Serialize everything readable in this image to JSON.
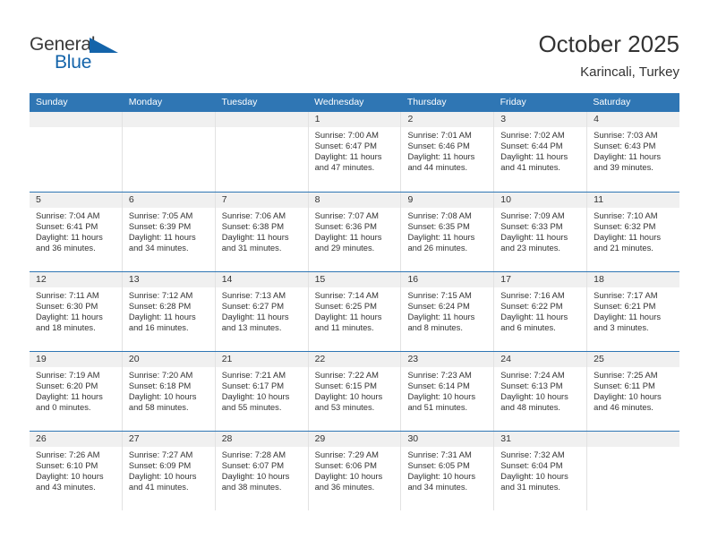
{
  "brand": {
    "name_part1": "General",
    "name_part2": "Blue",
    "accent_color": "#1464aa",
    "triangle_icon": "triangle-icon"
  },
  "header": {
    "title": "October 2025",
    "subtitle": "Karincali, Turkey"
  },
  "theme": {
    "header_blue": "#2f76b4",
    "date_band_gray": "#f0f0f0",
    "text_color": "#333333",
    "cell_divider": "#e2e2e2"
  },
  "calendar": {
    "weekday_headers": [
      "Sunday",
      "Monday",
      "Tuesday",
      "Wednesday",
      "Thursday",
      "Friday",
      "Saturday"
    ],
    "weeks": [
      [
        {
          "day": "",
          "empty": true,
          "sunrise": "",
          "sunset": "",
          "daylight_line1": "",
          "daylight_line2": ""
        },
        {
          "day": "",
          "empty": true,
          "sunrise": "",
          "sunset": "",
          "daylight_line1": "",
          "daylight_line2": ""
        },
        {
          "day": "",
          "empty": true,
          "sunrise": "",
          "sunset": "",
          "daylight_line1": "",
          "daylight_line2": ""
        },
        {
          "day": "1",
          "empty": false,
          "sunrise": "Sunrise: 7:00 AM",
          "sunset": "Sunset: 6:47 PM",
          "daylight_line1": "Daylight: 11 hours",
          "daylight_line2": "and 47 minutes."
        },
        {
          "day": "2",
          "empty": false,
          "sunrise": "Sunrise: 7:01 AM",
          "sunset": "Sunset: 6:46 PM",
          "daylight_line1": "Daylight: 11 hours",
          "daylight_line2": "and 44 minutes."
        },
        {
          "day": "3",
          "empty": false,
          "sunrise": "Sunrise: 7:02 AM",
          "sunset": "Sunset: 6:44 PM",
          "daylight_line1": "Daylight: 11 hours",
          "daylight_line2": "and 41 minutes."
        },
        {
          "day": "4",
          "empty": false,
          "sunrise": "Sunrise: 7:03 AM",
          "sunset": "Sunset: 6:43 PM",
          "daylight_line1": "Daylight: 11 hours",
          "daylight_line2": "and 39 minutes."
        }
      ],
      [
        {
          "day": "5",
          "empty": false,
          "sunrise": "Sunrise: 7:04 AM",
          "sunset": "Sunset: 6:41 PM",
          "daylight_line1": "Daylight: 11 hours",
          "daylight_line2": "and 36 minutes."
        },
        {
          "day": "6",
          "empty": false,
          "sunrise": "Sunrise: 7:05 AM",
          "sunset": "Sunset: 6:39 PM",
          "daylight_line1": "Daylight: 11 hours",
          "daylight_line2": "and 34 minutes."
        },
        {
          "day": "7",
          "empty": false,
          "sunrise": "Sunrise: 7:06 AM",
          "sunset": "Sunset: 6:38 PM",
          "daylight_line1": "Daylight: 11 hours",
          "daylight_line2": "and 31 minutes."
        },
        {
          "day": "8",
          "empty": false,
          "sunrise": "Sunrise: 7:07 AM",
          "sunset": "Sunset: 6:36 PM",
          "daylight_line1": "Daylight: 11 hours",
          "daylight_line2": "and 29 minutes."
        },
        {
          "day": "9",
          "empty": false,
          "sunrise": "Sunrise: 7:08 AM",
          "sunset": "Sunset: 6:35 PM",
          "daylight_line1": "Daylight: 11 hours",
          "daylight_line2": "and 26 minutes."
        },
        {
          "day": "10",
          "empty": false,
          "sunrise": "Sunrise: 7:09 AM",
          "sunset": "Sunset: 6:33 PM",
          "daylight_line1": "Daylight: 11 hours",
          "daylight_line2": "and 23 minutes."
        },
        {
          "day": "11",
          "empty": false,
          "sunrise": "Sunrise: 7:10 AM",
          "sunset": "Sunset: 6:32 PM",
          "daylight_line1": "Daylight: 11 hours",
          "daylight_line2": "and 21 minutes."
        }
      ],
      [
        {
          "day": "12",
          "empty": false,
          "sunrise": "Sunrise: 7:11 AM",
          "sunset": "Sunset: 6:30 PM",
          "daylight_line1": "Daylight: 11 hours",
          "daylight_line2": "and 18 minutes."
        },
        {
          "day": "13",
          "empty": false,
          "sunrise": "Sunrise: 7:12 AM",
          "sunset": "Sunset: 6:28 PM",
          "daylight_line1": "Daylight: 11 hours",
          "daylight_line2": "and 16 minutes."
        },
        {
          "day": "14",
          "empty": false,
          "sunrise": "Sunrise: 7:13 AM",
          "sunset": "Sunset: 6:27 PM",
          "daylight_line1": "Daylight: 11 hours",
          "daylight_line2": "and 13 minutes."
        },
        {
          "day": "15",
          "empty": false,
          "sunrise": "Sunrise: 7:14 AM",
          "sunset": "Sunset: 6:25 PM",
          "daylight_line1": "Daylight: 11 hours",
          "daylight_line2": "and 11 minutes."
        },
        {
          "day": "16",
          "empty": false,
          "sunrise": "Sunrise: 7:15 AM",
          "sunset": "Sunset: 6:24 PM",
          "daylight_line1": "Daylight: 11 hours",
          "daylight_line2": "and 8 minutes."
        },
        {
          "day": "17",
          "empty": false,
          "sunrise": "Sunrise: 7:16 AM",
          "sunset": "Sunset: 6:22 PM",
          "daylight_line1": "Daylight: 11 hours",
          "daylight_line2": "and 6 minutes."
        },
        {
          "day": "18",
          "empty": false,
          "sunrise": "Sunrise: 7:17 AM",
          "sunset": "Sunset: 6:21 PM",
          "daylight_line1": "Daylight: 11 hours",
          "daylight_line2": "and 3 minutes."
        }
      ],
      [
        {
          "day": "19",
          "empty": false,
          "sunrise": "Sunrise: 7:19 AM",
          "sunset": "Sunset: 6:20 PM",
          "daylight_line1": "Daylight: 11 hours",
          "daylight_line2": "and 0 minutes."
        },
        {
          "day": "20",
          "empty": false,
          "sunrise": "Sunrise: 7:20 AM",
          "sunset": "Sunset: 6:18 PM",
          "daylight_line1": "Daylight: 10 hours",
          "daylight_line2": "and 58 minutes."
        },
        {
          "day": "21",
          "empty": false,
          "sunrise": "Sunrise: 7:21 AM",
          "sunset": "Sunset: 6:17 PM",
          "daylight_line1": "Daylight: 10 hours",
          "daylight_line2": "and 55 minutes."
        },
        {
          "day": "22",
          "empty": false,
          "sunrise": "Sunrise: 7:22 AM",
          "sunset": "Sunset: 6:15 PM",
          "daylight_line1": "Daylight: 10 hours",
          "daylight_line2": "and 53 minutes."
        },
        {
          "day": "23",
          "empty": false,
          "sunrise": "Sunrise: 7:23 AM",
          "sunset": "Sunset: 6:14 PM",
          "daylight_line1": "Daylight: 10 hours",
          "daylight_line2": "and 51 minutes."
        },
        {
          "day": "24",
          "empty": false,
          "sunrise": "Sunrise: 7:24 AM",
          "sunset": "Sunset: 6:13 PM",
          "daylight_line1": "Daylight: 10 hours",
          "daylight_line2": "and 48 minutes."
        },
        {
          "day": "25",
          "empty": false,
          "sunrise": "Sunrise: 7:25 AM",
          "sunset": "Sunset: 6:11 PM",
          "daylight_line1": "Daylight: 10 hours",
          "daylight_line2": "and 46 minutes."
        }
      ],
      [
        {
          "day": "26",
          "empty": false,
          "sunrise": "Sunrise: 7:26 AM",
          "sunset": "Sunset: 6:10 PM",
          "daylight_line1": "Daylight: 10 hours",
          "daylight_line2": "and 43 minutes."
        },
        {
          "day": "27",
          "empty": false,
          "sunrise": "Sunrise: 7:27 AM",
          "sunset": "Sunset: 6:09 PM",
          "daylight_line1": "Daylight: 10 hours",
          "daylight_line2": "and 41 minutes."
        },
        {
          "day": "28",
          "empty": false,
          "sunrise": "Sunrise: 7:28 AM",
          "sunset": "Sunset: 6:07 PM",
          "daylight_line1": "Daylight: 10 hours",
          "daylight_line2": "and 38 minutes."
        },
        {
          "day": "29",
          "empty": false,
          "sunrise": "Sunrise: 7:29 AM",
          "sunset": "Sunset: 6:06 PM",
          "daylight_line1": "Daylight: 10 hours",
          "daylight_line2": "and 36 minutes."
        },
        {
          "day": "30",
          "empty": false,
          "sunrise": "Sunrise: 7:31 AM",
          "sunset": "Sunset: 6:05 PM",
          "daylight_line1": "Daylight: 10 hours",
          "daylight_line2": "and 34 minutes."
        },
        {
          "day": "31",
          "empty": false,
          "sunrise": "Sunrise: 7:32 AM",
          "sunset": "Sunset: 6:04 PM",
          "daylight_line1": "Daylight: 10 hours",
          "daylight_line2": "and 31 minutes."
        },
        {
          "day": "",
          "empty": true,
          "sunrise": "",
          "sunset": "",
          "daylight_line1": "",
          "daylight_line2": ""
        }
      ]
    ]
  }
}
